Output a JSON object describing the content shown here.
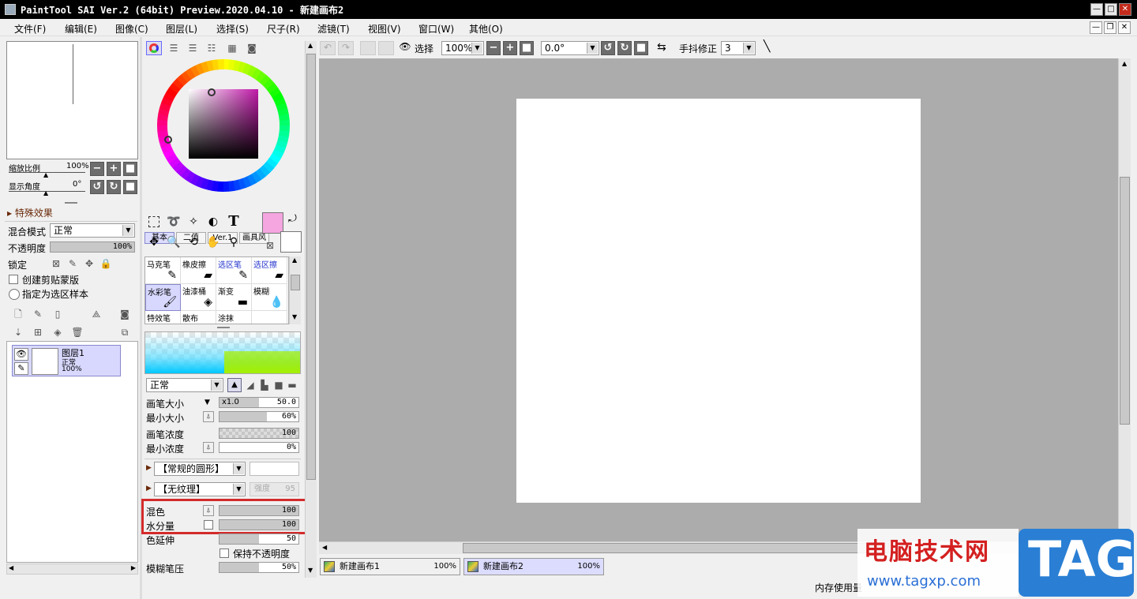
{
  "title_bar": {
    "title": "PaintTool SAI Ver.2 (64bit) Preview.2020.04.10 - 新建画布2"
  },
  "menu": [
    "文件(F)",
    "编辑(E)",
    "图像(C)",
    "图层(L)",
    "选择(S)",
    "尺子(R)",
    "滤镜(T)",
    "视图(V)",
    "窗口(W)",
    "其他(O)"
  ],
  "navigator": {
    "zoom_label": "缩放比例",
    "zoom_value": "100%",
    "angle_label": "显示角度",
    "angle_value": "0°"
  },
  "layer_panel": {
    "effects_label": "特殊效果",
    "blend_label": "混合模式",
    "blend_value": "正常",
    "opacity_label": "不透明度",
    "opacity_value": "100%",
    "lock_label": "锁定",
    "clip_label": "创建剪贴蒙版",
    "sample_label": "指定为选区样本",
    "layer": {
      "name": "图层1",
      "mode": "正常",
      "opacity": "100%"
    }
  },
  "color_tabs": [
    "基本",
    "二值",
    "Ver.1",
    "画具风"
  ],
  "tools": [
    "选择框",
    "套索",
    "魔棒",
    "填充",
    "文字",
    "移动",
    "放大",
    "旋转",
    "抓手",
    "吸管"
  ],
  "colors": {
    "primary": "#f5a6e0",
    "secondary": "#ffffff"
  },
  "brushes": [
    {
      "name": "马克笔",
      "icon": "✎"
    },
    {
      "name": "橡皮擦",
      "icon": "▰"
    },
    {
      "name": "选区笔",
      "icon": "✎",
      "blue": true
    },
    {
      "name": "选区擦",
      "icon": "▰",
      "blue": true
    },
    {
      "name": "水彩笔",
      "icon": "🖌",
      "selected": true
    },
    {
      "name": "油漆桶",
      "icon": "◈"
    },
    {
      "name": "渐变",
      "icon": "▬"
    },
    {
      "name": "模糊",
      "icon": "💧"
    },
    {
      "name": "特效笔",
      "icon": "✎"
    },
    {
      "name": "散布",
      "icon": "·"
    },
    {
      "name": "涂抹",
      "icon": "☝"
    },
    {
      "name": "",
      "icon": ""
    }
  ],
  "brush_settings": {
    "mode_value": "正常",
    "size_label": "画笔大小",
    "size_mult": "x1.0",
    "size_value": "50.0",
    "min_size_label": "最小大小",
    "min_size_value": "60%",
    "density_label": "画笔浓度",
    "density_value": "100",
    "min_density_label": "最小浓度",
    "min_density_value": "0%",
    "shape_value": "【常规的圆形】",
    "texture_value": "【无纹理】",
    "texture_strength_label": "强度",
    "texture_strength_value": "95",
    "mix_label": "混色",
    "mix_value": "100",
    "water_label": "水分量",
    "water_value": "100",
    "extend_label": "色延伸",
    "extend_value": "50",
    "keep_opacity_label": "保持不透明度",
    "blur_label": "模糊笔压",
    "blur_value": "50%"
  },
  "canvas_toolbar": {
    "select_label": "选择",
    "zoom_value": "100%",
    "angle_value": "0.0°",
    "stabilizer_label": "手抖修正",
    "stabilizer_value": "3"
  },
  "doc_tabs": [
    {
      "name": "新建画布1",
      "zoom": "100%"
    },
    {
      "name": "新建画布2",
      "zoom": "100%"
    }
  ],
  "status": {
    "memory_label": "内存使用量"
  },
  "watermark": {
    "text1": "电脑技术网",
    "url": "www.tagxp.com",
    "badge": "TAG"
  }
}
